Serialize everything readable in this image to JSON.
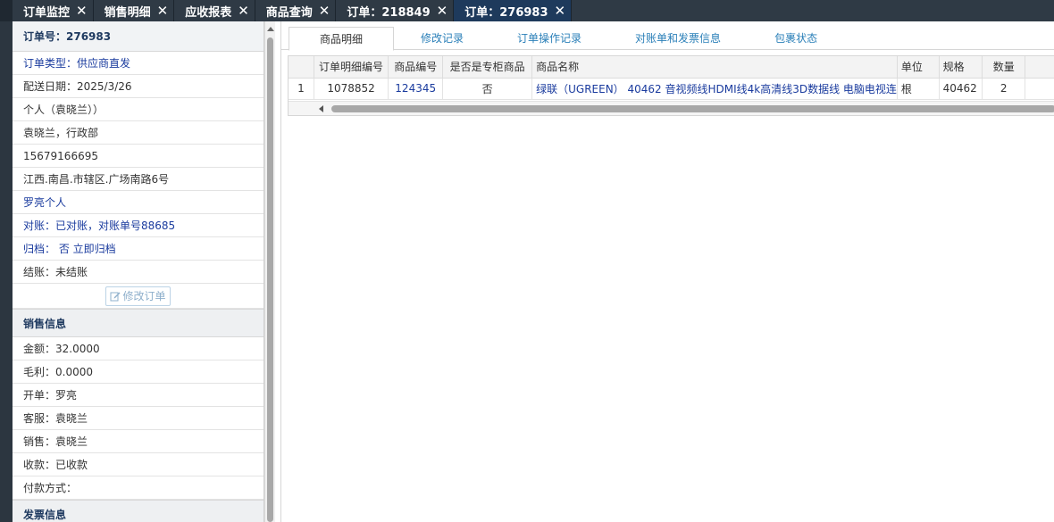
{
  "tabs": [
    {
      "label": "订单监控",
      "active": false
    },
    {
      "label": "销售明细",
      "active": false
    },
    {
      "label": "应收报表",
      "active": false
    },
    {
      "label": "商品查询",
      "active": false
    },
    {
      "label": "订单：218849",
      "active": false
    },
    {
      "label": "订单：276983",
      "active": true
    }
  ],
  "order": {
    "order_no": "订单号：276983",
    "type": "订单类型：供应商直发",
    "delivery_date": "配送日期：2025/3/26",
    "customer": "个人（袁晓兰））",
    "contact": "袁晓兰，行政部",
    "phone": "15679166695",
    "address": "江西.南昌.市辖区.广场南路6号",
    "account": "罗亮个人",
    "reconcile": "对账：已对账，对账单号88685",
    "archive": "归档： 否 立即归档",
    "settle": "结账：未结账",
    "edit_button": "修改订单"
  },
  "sales": {
    "section_title": "销售信息",
    "amount": "金额：32.0000",
    "gross_profit": "毛利：0.0000",
    "opener": "开单：罗亮",
    "service": "客服：袁晓兰",
    "seller": "销售：袁晓兰",
    "collection": "收款：已收款",
    "payment_method": "付款方式："
  },
  "invoice": {
    "section_title": "发票信息"
  },
  "subtabs": [
    "商品明细",
    "修改记录",
    "订单操作记录",
    "对账单和发票信息",
    "包裹状态"
  ],
  "table": {
    "columns": [
      "订单明细编号",
      "商品编号",
      "是否是专柜商品",
      "商品名称",
      "单位",
      "规格",
      "数量"
    ],
    "rows": [
      {
        "index": "1",
        "detail_no": "1078852",
        "product_no": "124345",
        "counter": "否",
        "name": "绿联（UGREEN） 40462 音视频线HDMI线4k高清线3D数据线 电脑电视连",
        "unit": "根",
        "spec": "40462",
        "qty": "2"
      }
    ]
  },
  "icons": {
    "tab_close": "close-icon",
    "edit": "edit-icon"
  }
}
